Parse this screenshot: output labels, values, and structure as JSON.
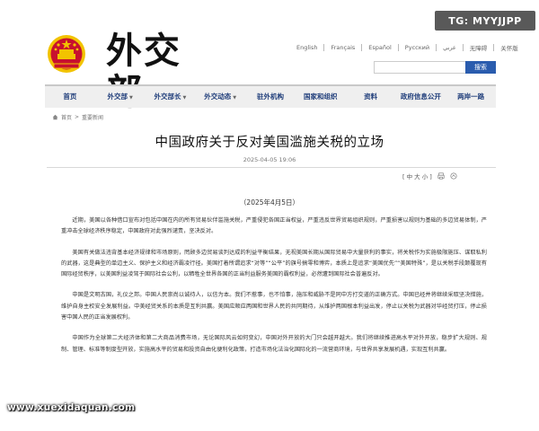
{
  "header": {
    "site_title": "外交部",
    "languages": [
      "English",
      "Français",
      "Español",
      "Русский",
      "عربي",
      "无障碍",
      "关怀版"
    ],
    "search_placeholder": "",
    "search_label": "搜索"
  },
  "overlay": {
    "tg_badge": "TG: MYYJJPP",
    "watermark": "www.xuexidaquan.com"
  },
  "nav": {
    "items": [
      {
        "label": "首页",
        "caret": false
      },
      {
        "label": "外交部",
        "caret": true
      },
      {
        "label": "外交部长",
        "caret": true
      },
      {
        "label": "外交动态",
        "caret": true
      },
      {
        "label": "驻外机构",
        "caret": false
      },
      {
        "label": "国家和组织",
        "caret": false
      },
      {
        "label": "资料",
        "caret": false
      },
      {
        "label": "政府信息公开",
        "caret": false
      },
      {
        "label": "两岸一路",
        "caret": false
      }
    ]
  },
  "breadcrumb": [
    "首页",
    "重要新闻"
  ],
  "article": {
    "title": "中国政府关于反对美国滥施关税的立场",
    "date": "2025-04-05 19:06",
    "font_controls": "[ 中 大 小 ]",
    "subdate": "（2025年4月5日）",
    "paragraphs": [
      "近期，美国以各种借口宣布对包括中国在内的所有贸易伙伴滥施关税，严重侵犯各国正当权益，严重违反世界贸易组织规则，严重损害以规则为基础的多边贸易体制，严重冲击全球经济秩序稳定，中国政府对此强烈谴责，坚决反对。",
      "美国有关做法违背基本经济规律和市场原则，罔顾多边贸易谈判达成的利益平衡结果，无视美国长期从国际贸易中大量获利的事实，将关税作为实施极限施压、谋取私利的武器，这是典型的单边主义、保护主义和经济霸凌行径。美国打着所谓追求“对等”“公平”的旗号搞零和博弈，本质上是追求“美国优先”“美国特殊”，是以关税手段颠覆现有国际经贸秩序，以美国利益凌驾于国际社会公利，以牺牲全世界各国的正当利益服务美国的霸权利益，必然遭到国际社会普遍反对。",
      "中国是文明古国，礼仪之邦。中国人民崇尚以诚待人，以信为本。我们不惹事，也不怕事，施压和威胁不是同中方打交道的正确方式。中国已经并将继续采取坚决措施，维护自身主权安全发展利益。中美经贸关系的本质是互利共赢。美国应顺应两国和世界人民的共同期待，从维护两国根本利益出发，停止以关税为武器对华经贸打压，停止损害中国人民的正当发展权利。",
      "中国作为全球第二大经济体和第二大商品消费市场，无论国际风云如何变幻，中国对外开放的大门只会越开越大。我们将继续推进高水平对外开放，稳步扩大规则、规制、管理、标准等制度型开放，实施高水平的贸易和投资自由化便利化政策，打造市场化法治化国际化的一流营商环境，与世界共享发展机遇，实现互利共赢。"
    ]
  },
  "colors": {
    "nav_text": "#1f3d7a",
    "search_button": "#2a5cae",
    "emblem_red": "#c8102e",
    "emblem_gold": "#f2c300"
  }
}
